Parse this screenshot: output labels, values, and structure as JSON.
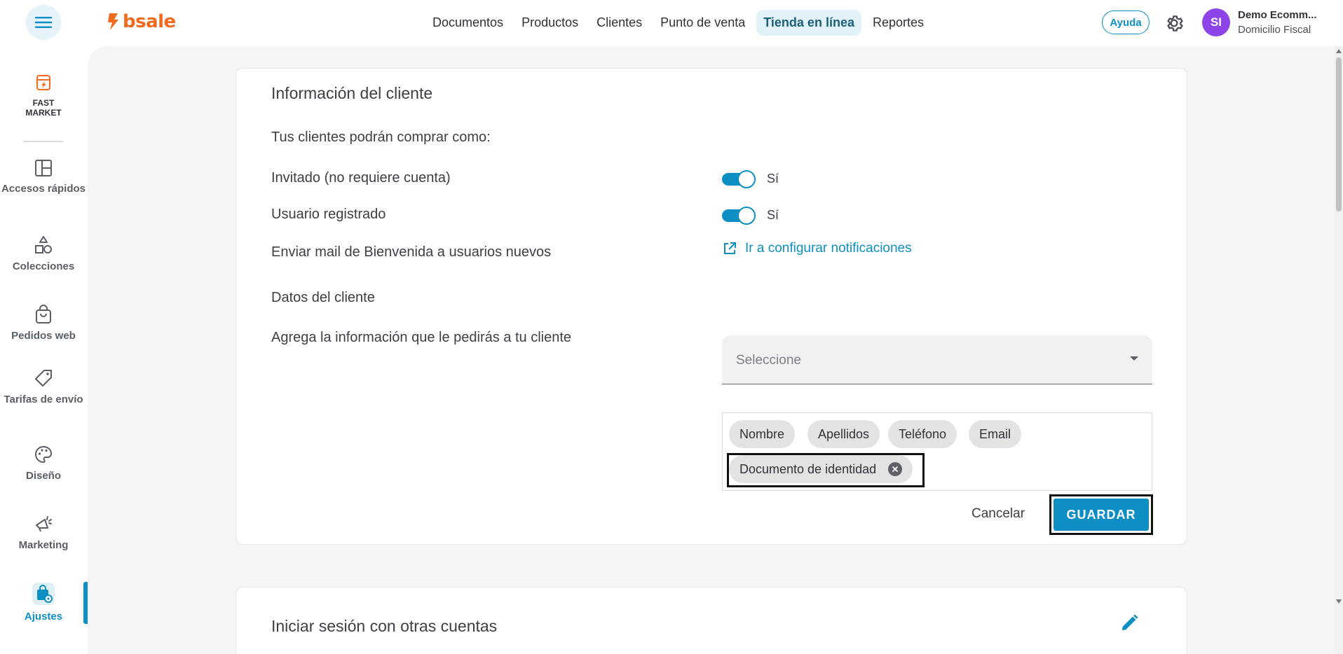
{
  "header": {
    "logo_text": "bsale",
    "nav": [
      {
        "label": "Documentos",
        "active": false
      },
      {
        "label": "Productos",
        "active": false
      },
      {
        "label": "Clientes",
        "active": false
      },
      {
        "label": "Punto de venta",
        "active": false
      },
      {
        "label": "Tienda en línea",
        "active": true
      },
      {
        "label": "Reportes",
        "active": false
      }
    ],
    "help_label": "Ayuda",
    "avatar_initials": "SI",
    "user_name": "Demo Ecomm...",
    "user_subtitle": "Domicilio Fiscal"
  },
  "sidebar": {
    "brand_line1": "FAST",
    "brand_line2": "MARKET",
    "items": [
      {
        "label": "Accesos rápidos",
        "icon": "layout-icon"
      },
      {
        "label": "Colecciones",
        "icon": "shapes-icon"
      },
      {
        "label": "Pedidos web",
        "icon": "shopping-bag-icon"
      },
      {
        "label": "Tarifas de envío",
        "icon": "tag-icon"
      },
      {
        "label": "Diseño",
        "icon": "palette-icon"
      },
      {
        "label": "Marketing",
        "icon": "megaphone-icon"
      },
      {
        "label": "Ajustes",
        "icon": "store-settings-icon",
        "active": true
      }
    ]
  },
  "customer_info": {
    "title": "Información del cliente",
    "buy_as_label": "Tus clientes podrán comprar como:",
    "guest_label": "Invitado (no requiere cuenta)",
    "guest_value": "Sí",
    "registered_label": "Usuario registrado",
    "registered_value": "Sí",
    "welcome_mail_label": "Enviar mail de Bienvenida a usuarios nuevos",
    "notifications_link": "Ir a configurar notificaciones",
    "customer_data_title": "Datos del cliente",
    "add_info_label": "Agrega la información que le pedirás a tu cliente",
    "select_placeholder": "Seleccione",
    "chips": [
      "Nombre",
      "Apellidos",
      "Teléfono",
      "Email",
      "Documento de identidad"
    ],
    "cancel_label": "Cancelar",
    "save_label": "GUARDAR"
  },
  "social_login": {
    "title": "Iniciar sesión con otras cuentas"
  },
  "colors": {
    "accent": "#0d8fc4",
    "brand": "#f26b1f",
    "avatar": "#8e44e8"
  }
}
